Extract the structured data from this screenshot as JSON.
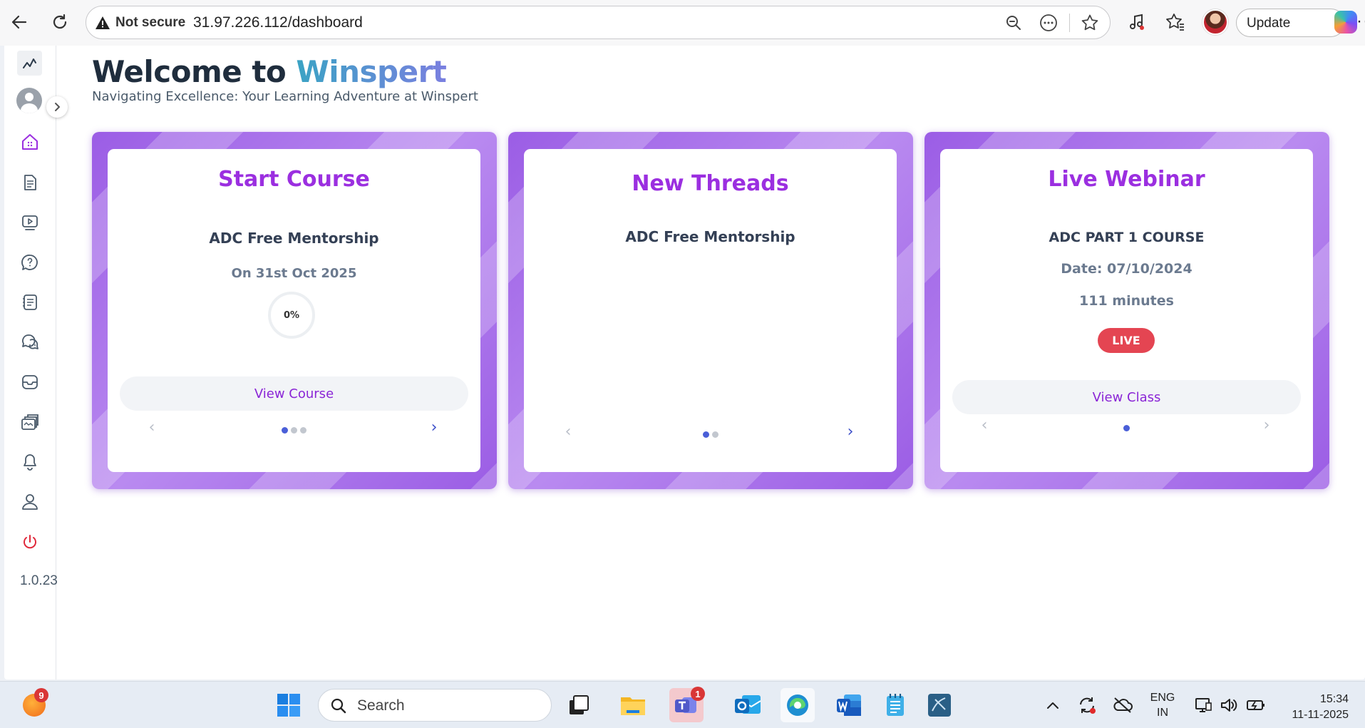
{
  "browser": {
    "security_label": "Not secure",
    "url": "31.97.226.112/dashboard",
    "update_label": "Update",
    "more_label": "···"
  },
  "sidebar": {
    "items": [
      {
        "name": "home",
        "icon": "home-icon",
        "active": true
      },
      {
        "name": "documents",
        "icon": "document-icon"
      },
      {
        "name": "videos",
        "icon": "video-icon"
      },
      {
        "name": "questions",
        "icon": "question-icon"
      },
      {
        "name": "notes",
        "icon": "notes-icon"
      },
      {
        "name": "discussions",
        "icon": "chat-icon"
      },
      {
        "name": "inbox",
        "icon": "inbox-icon"
      },
      {
        "name": "courses",
        "icon": "folders-icon"
      },
      {
        "name": "notifications",
        "icon": "bell-icon"
      },
      {
        "name": "profile",
        "icon": "user-icon"
      },
      {
        "name": "logout",
        "icon": "power-icon"
      }
    ],
    "version": "1.0.23"
  },
  "header": {
    "welcome_prefix": "Welcome to ",
    "brand": "Winspert",
    "subtitle": "Navigating Excellence: Your Learning Adventure at Winspert"
  },
  "cards": {
    "start_course": {
      "title": "Start Course",
      "course_name": "ADC Free Mentorship",
      "date": "On 31st Oct 2025",
      "progress_label": "0%",
      "progress": 0,
      "button_label": "View Course",
      "prev_arrow": "‹",
      "next_arrow": "›",
      "slides": 3,
      "active_slide": 1
    },
    "new_threads": {
      "title": "New Threads",
      "thread_name": "ADC Free Mentorship",
      "prev_arrow": "‹",
      "next_arrow": "›",
      "slides": 2,
      "active_slide": 1
    },
    "live_webinar": {
      "title": "Live Webinar",
      "course_name": "ADC PART 1 COURSE",
      "date": "Date: 07/10/2024",
      "duration": "111 minutes",
      "badge": "LIVE",
      "button_label": "View Class",
      "prev_arrow": "‹",
      "next_arrow": "›",
      "slides": 1,
      "active_slide": 1
    }
  },
  "taskbar": {
    "weather_badge": "9",
    "search_label": "Search",
    "teams_badge": "1",
    "language_line1": "ENG",
    "language_line2": "IN",
    "time": "15:34",
    "date": "11-11-2025"
  },
  "colors": {
    "accent_purple": "#9b2fe0",
    "live_red": "#e44552",
    "card_frame": "#9b5de5",
    "dot_active": "#4a5fd8"
  }
}
